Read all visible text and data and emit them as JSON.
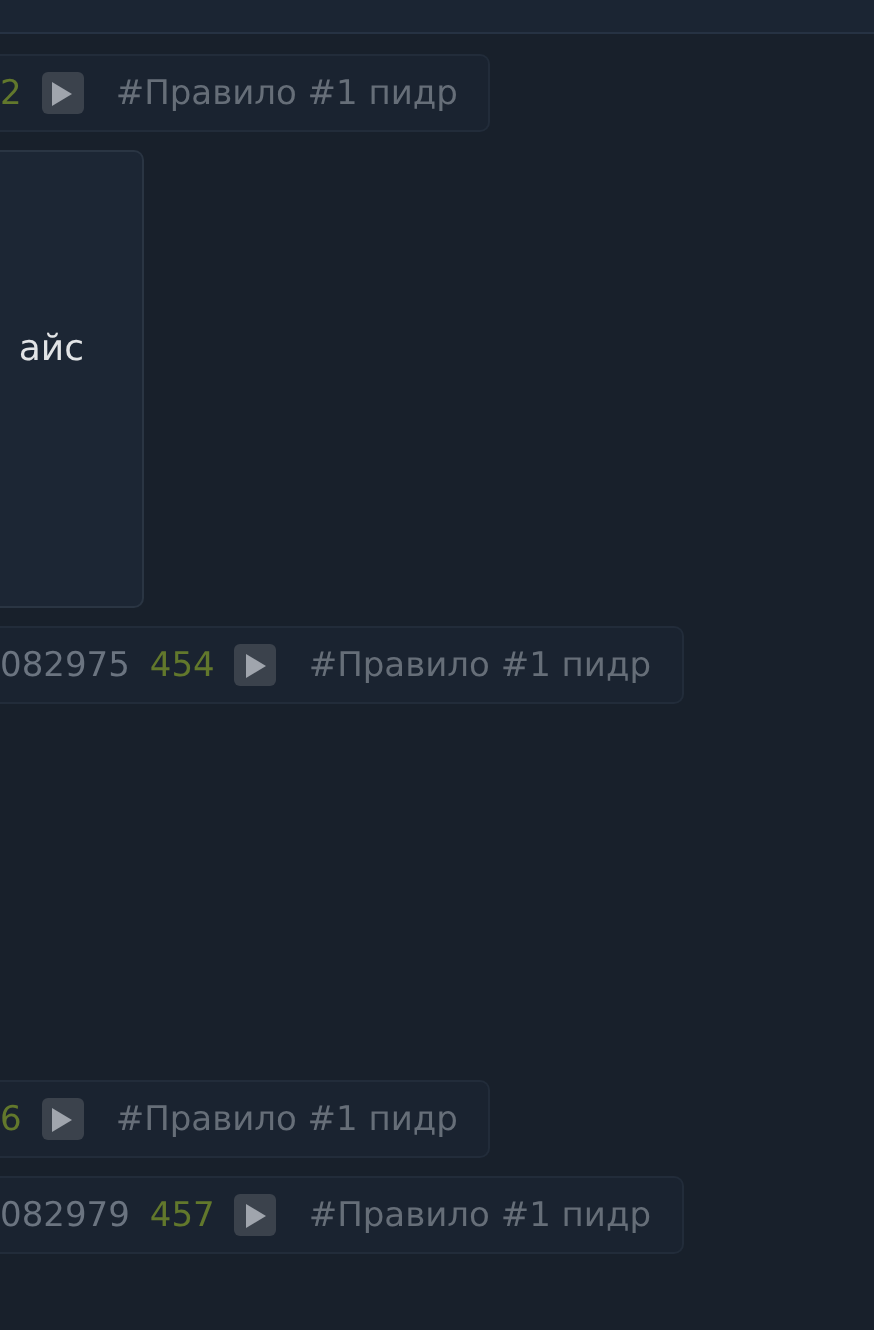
{
  "posts": [
    {
      "kind": "header",
      "reply_count": "2",
      "tag": "#Правило #1 пидр"
    },
    {
      "kind": "body",
      "text": "айс"
    },
    {
      "kind": "header",
      "number": "082975",
      "reply_count": "454",
      "tag": "#Правило #1 пидр"
    },
    {
      "kind": "header",
      "reply_count": "6",
      "tag": "#Правило #1 пидр"
    },
    {
      "kind": "header",
      "number": "082979",
      "reply_count": "457",
      "tag": "#Правило #1 пидр"
    }
  ]
}
